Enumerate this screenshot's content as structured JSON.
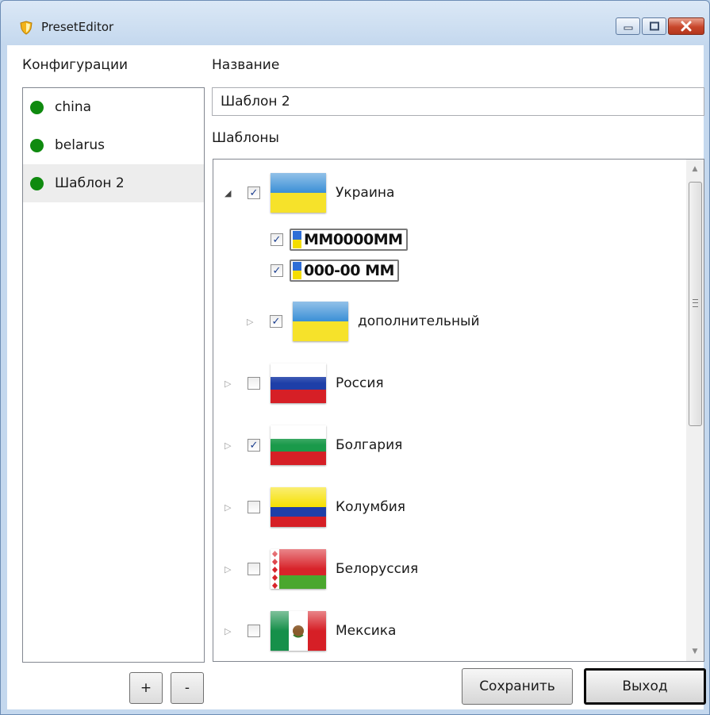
{
  "window": {
    "title": "PresetEditor",
    "controls": [
      "minimize-icon",
      "maximize-icon",
      "close-icon"
    ]
  },
  "configs": {
    "label": "Конфигурации",
    "items": [
      {
        "name": "china",
        "status_color": "#0f8a0f",
        "selected": false
      },
      {
        "name": "belarus",
        "status_color": "#0f8a0f",
        "selected": false
      },
      {
        "name": "Шаблон 2",
        "status_color": "#0f8a0f",
        "selected": true
      }
    ],
    "add_label": "+",
    "remove_label": "-"
  },
  "name_field": {
    "label": "Название",
    "value": "Шаблон 2"
  },
  "templates": {
    "label": "Шаблоны",
    "nodes": [
      {
        "name": "Украина",
        "checked": true,
        "expanded": true,
        "flag": "ukraine-flag",
        "children": [
          {
            "plate": "MM0000MM",
            "checked": true
          },
          {
            "plate": "000-00 MM",
            "checked": true
          },
          {
            "name": "дополнительный",
            "checked": true,
            "expanded": false,
            "flag": "ukraine-flag"
          }
        ]
      },
      {
        "name": "Россия",
        "checked": false,
        "expanded": false,
        "flag": "russia-flag"
      },
      {
        "name": "Болгария",
        "checked": true,
        "expanded": false,
        "flag": "bulgaria-flag"
      },
      {
        "name": "Колумбия",
        "checked": false,
        "expanded": false,
        "flag": "colombia-flag"
      },
      {
        "name": "Белоруссия",
        "checked": false,
        "expanded": false,
        "flag": "belarus-flag"
      },
      {
        "name": "Мексика",
        "checked": false,
        "expanded": false,
        "flag": "mexico-flag"
      }
    ]
  },
  "buttons": {
    "save": "Сохранить",
    "exit": "Выход"
  },
  "glyphs": {
    "expanded": "◢",
    "collapsed": "▷",
    "check": "✓"
  },
  "colors": {
    "status_dot": "#0f8a0f",
    "window_frame": "#b9d1ea",
    "close_button": "#c8462b"
  }
}
